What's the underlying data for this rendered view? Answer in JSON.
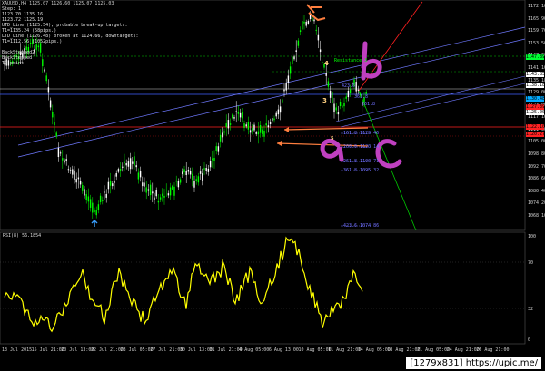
{
  "window": {
    "title_line": "XAUUSD,H4  1125.07 1126.60 1125.07 1125.03"
  },
  "indicator_text": [
    "Step: 1",
    "1123.70  1135.16",
    "1123.72  1125.19",
    "UTD_Line (1125.54), probable break-up targets:",
    "T1=1135.24 (58pips.)",
    "LTD_Line (1126.48) broken at 1124.66, downtargets:",
    "T1=1112.56 (1052pips.)",
    "",
    "BackStepped2",
    "BackStepped",
    "TD point"
  ],
  "price_axis": {
    "labels": [
      "1172.10",
      "1165.90",
      "1159.70",
      "1153.50",
      "1147.30",
      "1141.10",
      "1135.18",
      "1129.00",
      "1123.00",
      "1117.10",
      "1111.00",
      "1105.00",
      "1098.80",
      "1092.70",
      "1086.60",
      "1080.40",
      "1074.20",
      "1068.10"
    ],
    "tags": [
      {
        "text": "1147.89",
        "color": "#00ff33"
      },
      {
        "text": "1143.85",
        "color": "#ffffff"
      },
      {
        "text": "1138.18",
        "color": "#ffffff"
      },
      {
        "text": "1130.48",
        "color": "#00aaff"
      },
      {
        "text": "1127.39",
        "color": "#ff2222"
      },
      {
        "text": "1125.00",
        "color": "#ffffff"
      },
      {
        "text": "1122.10",
        "color": "#ff2222"
      },
      {
        "text": "1120.27",
        "color": "#ff2222"
      }
    ]
  },
  "time_axis": [
    "13 Jul 2015",
    "15 Jul 21:00",
    "20 Jul 13:00",
    "22 Jul 21:00",
    "23 Jul 05:00",
    "27 Jul 21:00",
    "30 Jul 13:00",
    "31 Jul 21:00",
    "4 Aug 05:00",
    "6 Aug 13:00",
    "10 Aug 05:00",
    "11 Aug 21:00",
    "14 Aug 05:00",
    "18 Aug 21:00",
    "21 Aug 05:00",
    "24 Aug 21:00",
    "26 Aug 21:00"
  ],
  "chart_labels": {
    "resistance": "Resistance 3",
    "fib_labels": [
      "161.8  1129.46",
      "200.0  1120.14",
      "261.8  1100.71",
      "361.8  1095.32",
      "423.6  1074.86",
      "361.8",
      "423.6",
      "261.8"
    ],
    "wave_numbers": [
      "4",
      "3",
      "5"
    ],
    "wave_letters": [
      "a",
      "b",
      "c"
    ],
    "extra": "B",
    "extra2": "point"
  },
  "rsi": {
    "label": "RSI(8) 56.1854",
    "scale": [
      "100",
      "70",
      "32",
      "0"
    ]
  },
  "badge": "[1279x831] https://upic.me/",
  "colors": {
    "bull": "#00ff00",
    "bear": "#ffffff",
    "rsi": "#ffff00",
    "channel": "#6f79ff",
    "hline_blue": "#4060ff",
    "hline_red": "#ff2020",
    "hline_green": "#00cc00",
    "orange": "#ff7f3f",
    "magenta": "#c040c0"
  }
}
